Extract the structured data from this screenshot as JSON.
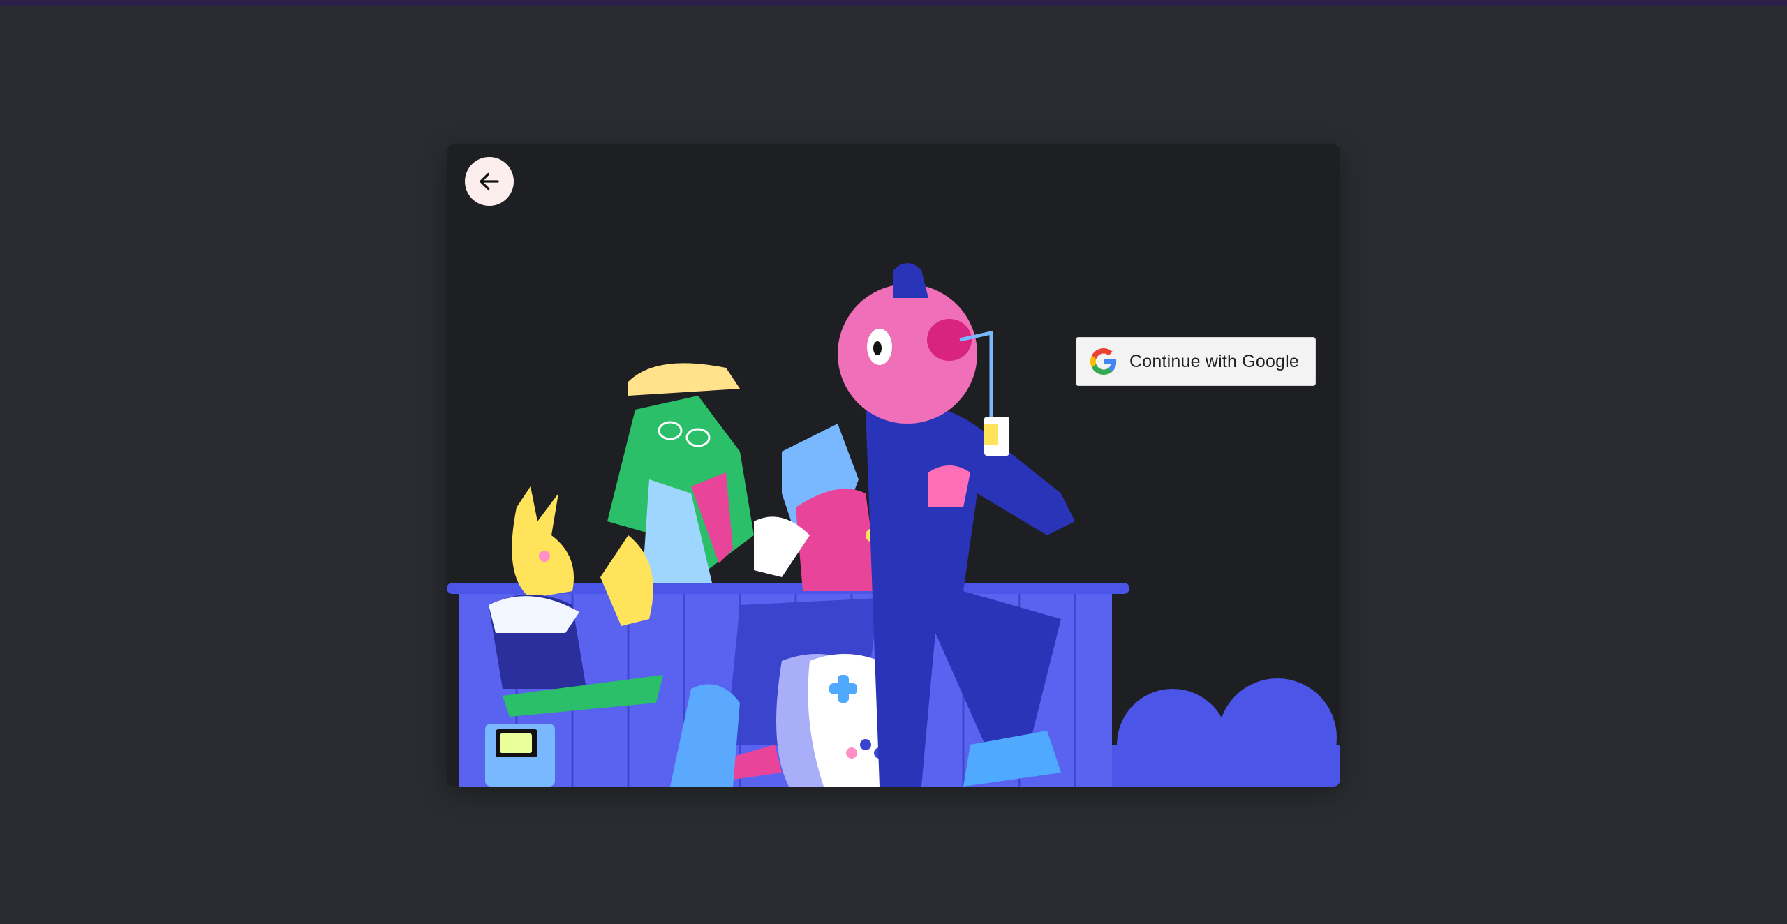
{
  "colors": {
    "background": "#2a2c31",
    "modal_background": "#1e1f22",
    "top_accent": "#2b2047",
    "back_button": "#fdeeee",
    "illustration_blue": "#4b55e8",
    "google_button_bg": "#f3f3f3"
  },
  "modal": {
    "back_button_icon": "arrow-left-icon",
    "illustration_icon": "characters-hangout-illustration"
  },
  "auth": {
    "google_button_label": "Continue with Google",
    "google_icon": "google-g-icon"
  }
}
